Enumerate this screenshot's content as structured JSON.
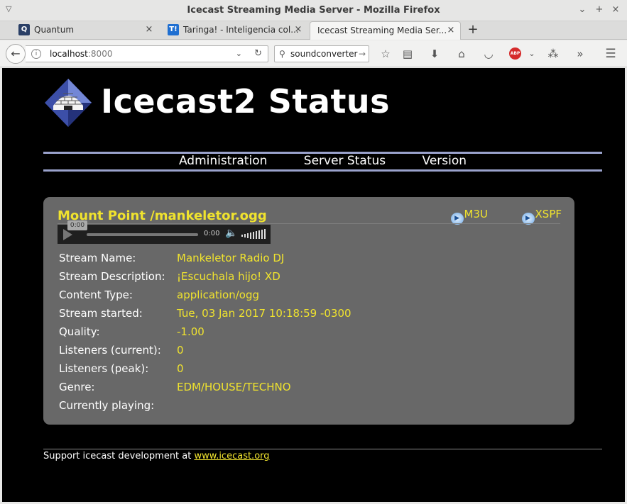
{
  "window": {
    "title": "Icecast Streaming Media Server - Mozilla Firefox"
  },
  "tabs": [
    {
      "label": "Quantum",
      "active": false,
      "favicon": "quantum-icon"
    },
    {
      "label": "Taringa! - Inteligencia col...",
      "active": false,
      "favicon": "taringa-icon"
    },
    {
      "label": "Icecast Streaming Media Ser...",
      "active": true
    }
  ],
  "toolbar": {
    "url_host": "localhost",
    "url_port": ":8000",
    "search_value": "soundconverter",
    "abp_label": "ABP"
  },
  "page": {
    "heading": "Icecast2 Status",
    "nav": [
      "Administration",
      "Server Status",
      "Version"
    ],
    "mount": {
      "title": "Mount Point /mankeletor.ogg",
      "links": [
        "M3U",
        "XSPF"
      ],
      "player": {
        "elapsed_tip": "0:00",
        "time": "0:00"
      },
      "fields": [
        {
          "label": "Stream Name:",
          "value": "Mankeletor Radio DJ"
        },
        {
          "label": "Stream Description:",
          "value": "¡Escuchala hijo! XD"
        },
        {
          "label": "Content Type:",
          "value": "application/ogg"
        },
        {
          "label": "Stream started:",
          "value": "Tue, 03 Jan 2017 10:18:59 -0300"
        },
        {
          "label": "Quality:",
          "value": "-1.00"
        },
        {
          "label": "Listeners (current):",
          "value": "0"
        },
        {
          "label": "Listeners (peak):",
          "value": "0"
        },
        {
          "label": "Genre:",
          "value": "EDM/HOUSE/TECHNO"
        },
        {
          "label": "Currently playing:",
          "value": ""
        }
      ]
    },
    "footer": {
      "text": "Support icecast development at ",
      "link": "www.icecast.org"
    }
  },
  "colors": {
    "accent_yellow": "#f0e32e",
    "nav_line": "#9aa2cc",
    "panel": "#686868"
  }
}
